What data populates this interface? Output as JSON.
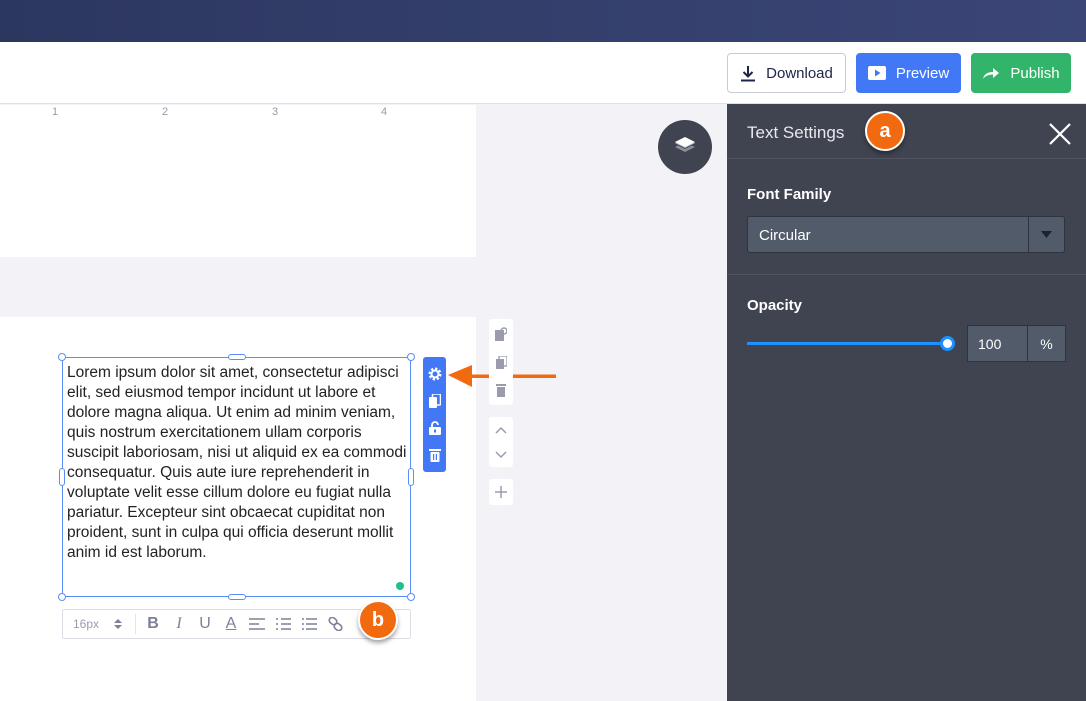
{
  "toolbar": {
    "download": "Download",
    "preview": "Preview",
    "publish": "Publish"
  },
  "canvas": {
    "ruler": [
      "1",
      "2",
      "3",
      "4"
    ],
    "text": "Lorem ipsum dolor sit amet, consectetur adipisci elit, sed eiusmod tempor incidunt ut labore et dolore magna aliqua. Ut enim ad minim veniam, quis nostrum exercitationem ullam corporis suscipit laboriosam, nisi ut aliquid ex ea commodi consequatur. Quis aute iure reprehenderit in voluptate velit esse cillum dolore eu fugiat nulla pariatur. Excepteur sint obcaecat cupiditat non proident, sunt in culpa qui officia deserunt mollit anim id est laborum.",
    "format": {
      "font_size": "16px",
      "icons": [
        "bold-icon",
        "italic-icon",
        "underline-icon",
        "text-color-icon",
        "align-left-icon",
        "numbered-list-icon",
        "bullet-list-icon",
        "link-icon"
      ]
    }
  },
  "panel": {
    "title": "Text Settings",
    "font_family_label": "Font Family",
    "font_family_value": "Circular",
    "opacity_label": "Opacity",
    "opacity_value": "100",
    "opacity_unit": "%",
    "opacity_percent": 100
  },
  "markers": {
    "a": "a",
    "b": "b"
  },
  "colors": {
    "accent": "#4277f6",
    "publish": "#33b46b",
    "marker": "#f26a0f",
    "panel": "#3f4450",
    "slider": "#1e90ff"
  }
}
